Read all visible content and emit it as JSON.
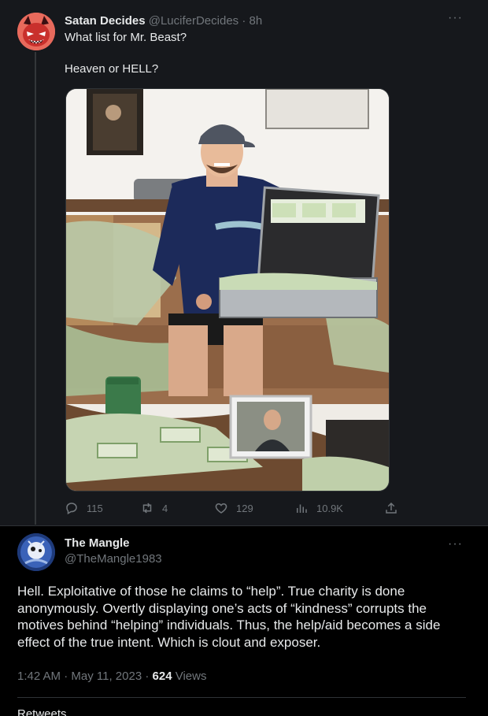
{
  "tweet": {
    "author_name": "Satan Decides",
    "author_handle": "@LuciferDecides",
    "separator": " · ",
    "time_ago": "8h",
    "line1": "What list for Mr. Beast?",
    "line2": "Heaven or HELL?",
    "more_label": "···",
    "stats": {
      "replies": "115",
      "retweets": "4",
      "likes": "129",
      "views": "10.9K"
    }
  },
  "reply": {
    "author_name": "The Mangle",
    "author_handle": "@TheMangle1983",
    "more_label": "···",
    "text": "Hell. Exploitative of those he claims to “help”. True charity is done anonymously. Overtly displaying one’s acts of “kindness” corrupts the motives behind “helping” individuals. Thus, the help/aid becomes a side effect of the true intent. Which is clout and exposer.",
    "time": "1:42 AM",
    "date": "May 11, 2023",
    "dot": " · ",
    "views_count": "624",
    "views_label": " Views",
    "cutoff_text": "Retweets"
  },
  "colors": {
    "background": "#000000",
    "tweet_background": "#16181c",
    "text": "#e7e9ea",
    "muted": "#71767b",
    "border": "#2f3336"
  },
  "icons": [
    "reply-icon",
    "retweet-icon",
    "like-icon",
    "views-icon",
    "share-icon",
    "more-icon"
  ]
}
